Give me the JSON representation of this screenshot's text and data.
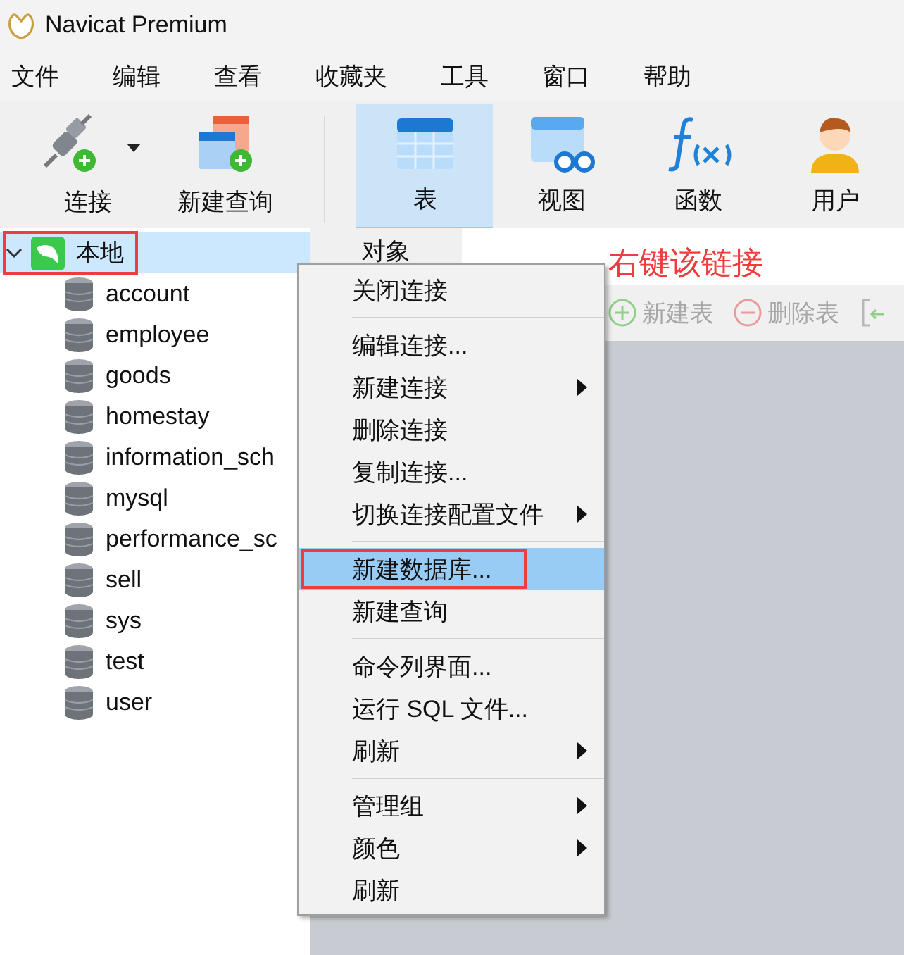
{
  "window": {
    "title": "Navicat Premium"
  },
  "menubar": [
    "文件",
    "编辑",
    "查看",
    "收藏夹",
    "工具",
    "窗口",
    "帮助"
  ],
  "toolbar": [
    {
      "kind": "connect",
      "label": "连接",
      "dropdown": true,
      "selected": false
    },
    {
      "kind": "query",
      "label": "新建查询",
      "dropdown": false,
      "selected": false
    },
    {
      "kind": "table",
      "label": "表",
      "dropdown": false,
      "selected": true
    },
    {
      "kind": "view",
      "label": "视图",
      "dropdown": false,
      "selected": false
    },
    {
      "kind": "function",
      "label": "函数",
      "dropdown": false,
      "selected": false
    },
    {
      "kind": "user",
      "label": "用户",
      "dropdown": false,
      "selected": false
    }
  ],
  "tree": [
    {
      "label": "本地",
      "expanded": true,
      "annotated": true,
      "selected": true,
      "children": [
        {
          "label": "account"
        },
        {
          "label": "employee"
        },
        {
          "label": "goods"
        },
        {
          "label": "homestay"
        },
        {
          "label": "information_sch"
        },
        {
          "label": "mysql"
        },
        {
          "label": "performance_sc"
        },
        {
          "label": "sell"
        },
        {
          "label": "sys"
        },
        {
          "label": "test"
        },
        {
          "label": "user"
        }
      ]
    }
  ],
  "tabs": [
    {
      "label": "对象",
      "selected": true
    }
  ],
  "annotation": "右键该链接",
  "object_toolbar": [
    {
      "kind": "add",
      "label": "新建表",
      "disabled": true
    },
    {
      "kind": "remove",
      "label": "删除表",
      "disabled": true
    },
    {
      "kind": "import",
      "disabled": true
    }
  ],
  "context_menu": [
    {
      "kind": "item",
      "label": "关闭连接",
      "submenu": false,
      "selected": false,
      "annotated": false
    },
    {
      "kind": "separator"
    },
    {
      "kind": "item",
      "label": "编辑连接...",
      "submenu": false,
      "selected": false,
      "annotated": false
    },
    {
      "kind": "item",
      "label": "新建连接",
      "submenu": true,
      "selected": false,
      "annotated": false
    },
    {
      "kind": "item",
      "label": "删除连接",
      "submenu": false,
      "selected": false,
      "annotated": false
    },
    {
      "kind": "item",
      "label": "复制连接...",
      "submenu": false,
      "selected": false,
      "annotated": false
    },
    {
      "kind": "item",
      "label": "切换连接配置文件",
      "submenu": true,
      "selected": false,
      "annotated": false
    },
    {
      "kind": "separator"
    },
    {
      "kind": "item",
      "label": "新建数据库...",
      "submenu": false,
      "selected": true,
      "annotated": true
    },
    {
      "kind": "item",
      "label": "新建查询",
      "submenu": false,
      "selected": false,
      "annotated": false
    },
    {
      "kind": "separator"
    },
    {
      "kind": "item",
      "label": "命令列界面...",
      "submenu": false,
      "selected": false,
      "annotated": false
    },
    {
      "kind": "item",
      "label": "运行 SQL 文件...",
      "submenu": false,
      "selected": false,
      "annotated": false
    },
    {
      "kind": "item",
      "label": "刷新",
      "submenu": true,
      "selected": false,
      "annotated": false
    },
    {
      "kind": "separator"
    },
    {
      "kind": "item",
      "label": "管理组",
      "submenu": true,
      "selected": false,
      "annotated": false
    },
    {
      "kind": "item",
      "label": "颜色",
      "submenu": true,
      "selected": false,
      "annotated": false
    },
    {
      "kind": "item",
      "label": "刷新",
      "submenu": false,
      "selected": false,
      "annotated": false
    }
  ]
}
